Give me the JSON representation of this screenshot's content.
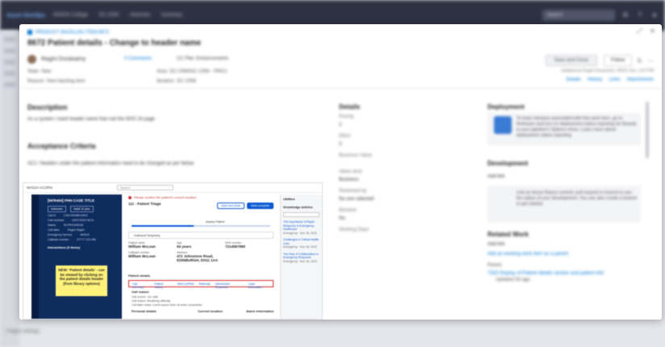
{
  "topbar": {
    "brand": "Azure DevOps",
    "crumbs": [
      "NHSUK College",
      "DC CRM",
      "Overview",
      "Summary"
    ],
    "search_placeholder": "Search",
    "icons": [
      "settings-icon",
      "help-icon",
      "user-icon"
    ]
  },
  "workitem": {
    "type": "PRODUCT BACKLOG ITEM 8672",
    "title": "8672 Patient details - Change to header name",
    "assignee": "Ragini Duraisamy",
    "comments": "0 Comments",
    "tag": "CC Plat: Enhancements",
    "state_label": "State",
    "state_value": "New",
    "area_label": "Area",
    "area_value": "DC CRM\\DC CRM - PROJ",
    "reason_label": "Reason",
    "reason_value": "New backlog item",
    "iteration_label": "Iteration",
    "iteration_value": "DC CRM",
    "save_label": "Save and Close",
    "follow_label": "Follow",
    "updated_text": "Updated by Ragini Duraisamy: 4/5/21 Dec, 3:47 PM",
    "tabs": [
      "Details",
      "History",
      "Links",
      "Attachments"
    ]
  },
  "description": {
    "heading": "Description",
    "text": "As a system I want header name that suit the NHS 24 page"
  },
  "acceptance": {
    "heading": "Acceptance Criteria",
    "text": "AC1: Headers under the patient information need to be changed as per below"
  },
  "details": {
    "heading": "Details",
    "fields": [
      "Priority",
      "2",
      "Effort",
      "3",
      "Business Value",
      "Value area",
      "Business",
      "Reviewed by",
      "No one selected",
      "Blocked",
      "No",
      "Working Days"
    ]
  },
  "deployment": {
    "heading": "Deployment",
    "text": "To track releases associated with this work item, go to Releases and turn on deployment status reporting for Boards in your pipeline's Options menu. Learn more about deployment status reporting"
  },
  "development": {
    "heading": "Development",
    "add_link": "Add link",
    "text": "Link an Azure Repos commit, pull request or branch to see the status of your development. You can also create a branch to get started."
  },
  "related": {
    "heading": "Related Work",
    "add_link": "Add link",
    "add_existing": "Add an existing work item as a parent",
    "parent_label": "Parent",
    "parent_item": "7325 Display of Patient details section and patient info",
    "parent_meta": "Updated 5d ago"
  },
  "screenshot": {
    "app_name": "NHS24 ACORN",
    "search": "Search",
    "patient_title": "[NFR404] PHH CASE TITLE",
    "chips": [
      "Unknown",
      "Adult 12 plus"
    ],
    "left_rows": [
      [
        "Call Id",
        "CAS-004989-A4K2"
      ],
      [
        "Call received",
        "03/07/2023 09:21"
      ],
      [
        "Status",
        "IN PROGRESS"
      ],
      [
        "Call taker",
        "Ragini Ragini"
      ],
      [
        "Emergency Service",
        "NHS24"
      ],
      [
        "Callback number",
        "07777 123 456"
      ]
    ],
    "interactions_label": "Interactions (0 items)",
    "callout": "NEW: 'Patient details' - can be viewed by clicking on the patient details header (from library options)",
    "warning": "Please confirm the patient's current location",
    "main_heading": "111 - Patient Triage",
    "btn_save": "Save and close",
    "btn_complete": "Mark complete",
    "progress_label": "Assess Patient",
    "progress_percent": 45,
    "telephony": "Outbound Telephony",
    "grid": [
      [
        "Patient name",
        "William McLean"
      ],
      [
        "Age",
        "64 years"
      ],
      [
        "NHS number",
        "7214567890"
      ],
      [
        "Callback number",
        "William McLean"
      ],
      [
        "Address",
        "472 Johnstone Road, EDINBURGH, EH11 1AA"
      ],
      [
        "",
        ""
      ]
    ],
    "patient_details": "Patient details",
    "tabs": [
      "Call summary",
      "Patient history",
      "SMCCs/PEW",
      "Referrals",
      "Intervention Response",
      "Case information"
    ],
    "call_reason_heading": "Call reason",
    "call_rows": [
      "Call source: 111 calls",
      "Call reason: Breathing difficulty",
      "Call taker notes: Lorem ipsum dolor sit amet consectetur"
    ],
    "personal_details": "Personal details",
    "current_location": "Current location",
    "alarm_info": "Alarm information",
    "util_title": "Utilities",
    "ka_title": "Knowledge articles",
    "articles": [
      [
        "The importance of Rapid Response in Emergency Healthcare",
        "Emergency · Nov 18, 2023"
      ],
      [
        "Challenges in Critical Health Care",
        "Emergency · Nov 18, 2023"
      ],
      [
        "The Role of Collaboration in Emergency Response",
        "Emergency · Nov 18, 2023"
      ]
    ]
  },
  "bottom": {
    "label": "Project settings"
  }
}
